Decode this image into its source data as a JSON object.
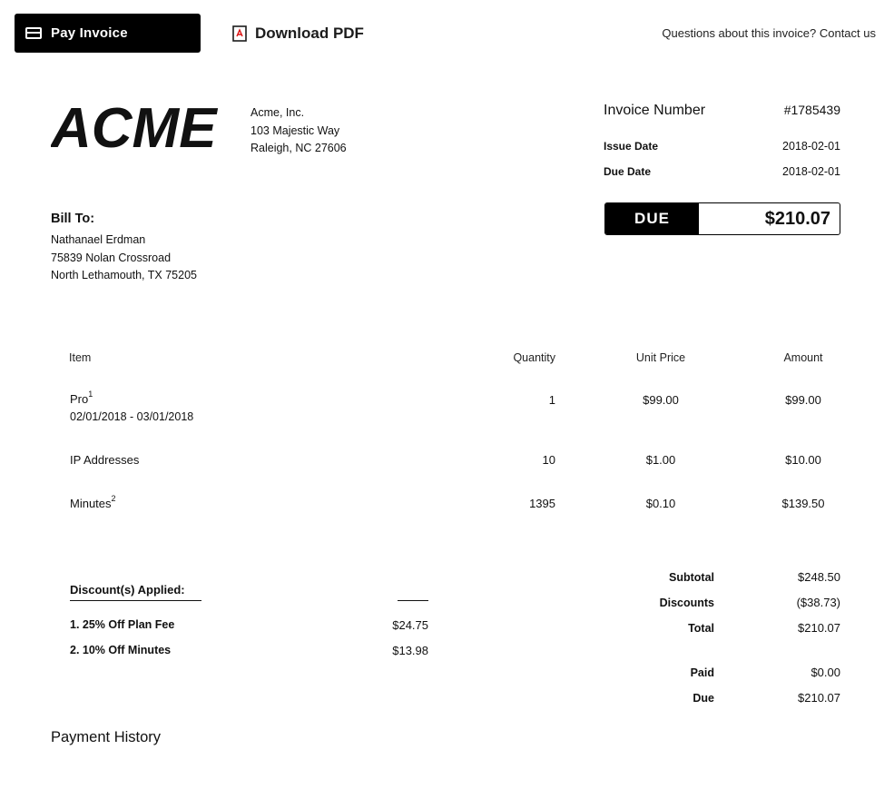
{
  "topbar": {
    "pay_button": "Pay Invoice",
    "download_label": "Download PDF",
    "contact_text": "Questions about this invoice? Contact us"
  },
  "logo": {
    "text": "ACME"
  },
  "company": {
    "name": "Acme, Inc.",
    "address1": "103 Majestic Way",
    "address2": "Raleigh, NC 27606"
  },
  "invoice": {
    "number_label": "Invoice Number",
    "number_value": "#1785439",
    "issue_label": "Issue Date",
    "issue_value": "2018-02-01",
    "due_label": "Due Date",
    "due_value": "2018-02-01",
    "due_tag": "DUE",
    "due_amount": "$210.07"
  },
  "bill_to": {
    "title": "Bill To:",
    "name": "Nathanael Erdman",
    "address1": "75839 Nolan Crossroad",
    "address2": "North Lethamouth, TX 75205"
  },
  "table": {
    "headers": {
      "item": "Item",
      "quantity": "Quantity",
      "unit_price": "Unit Price",
      "amount": "Amount"
    },
    "rows": [
      {
        "item": "Pro",
        "sup": "1",
        "sub": "02/01/2018 - 03/01/2018",
        "quantity": "1",
        "unit_price": "$99.00",
        "amount": "$99.00"
      },
      {
        "item": "IP Addresses",
        "sup": "",
        "sub": "",
        "quantity": "10",
        "unit_price": "$1.00",
        "amount": "$10.00"
      },
      {
        "item": "Minutes",
        "sup": "2",
        "sub": "",
        "quantity": "1395",
        "unit_price": "$0.10",
        "amount": "$139.50"
      }
    ]
  },
  "discounts": {
    "title": "Discount(s) Applied:",
    "items": [
      {
        "label": "1. 25% Off Plan Fee",
        "amount": "$24.75"
      },
      {
        "label": "2. 10% Off Minutes",
        "amount": "$13.98"
      }
    ]
  },
  "totals": {
    "subtotal_label": "Subtotal",
    "subtotal_value": "$248.50",
    "discounts_label": "Discounts",
    "discounts_value": "($38.73)",
    "total_label": "Total",
    "total_value": "$210.07",
    "paid_label": "Paid",
    "paid_value": "$0.00",
    "due_label": "Due",
    "due_value": "$210.07"
  },
  "payment_history": {
    "title": "Payment History"
  }
}
